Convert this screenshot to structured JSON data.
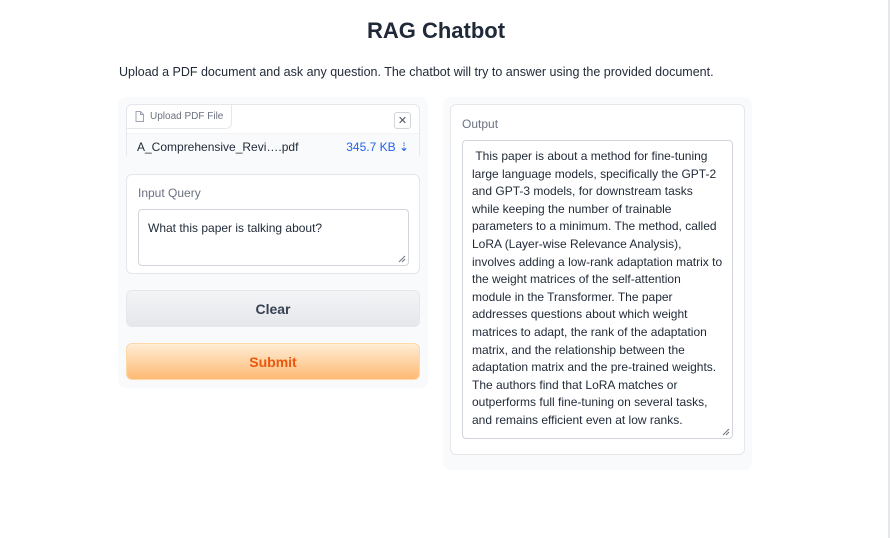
{
  "header": {
    "title": "RAG Chatbot",
    "description": "Upload a PDF document and ask any question. The chatbot will try to answer using the provided document."
  },
  "file_upload": {
    "label": "Upload PDF File",
    "label_icon": "file-icon",
    "close_glyph": "✕",
    "file_name": "A_Comprehensive_Revi….pdf",
    "file_size": "345.7 KB ⇣"
  },
  "query": {
    "label": "Input Query",
    "value": "What this paper is talking about?"
  },
  "buttons": {
    "clear_label": "Clear",
    "submit_label": "Submit"
  },
  "output": {
    "label": "Output",
    "value": " This paper is about a method for fine-tuning large language models, specifically the GPT-2 and GPT-3 models, for downstream tasks while keeping the number of trainable parameters to a minimum. The method, called LoRA (Layer-wise Relevance Analysis), involves adding a low-rank adaptation matrix to the weight matrices of the self-attention module in the Transformer. The paper addresses questions about which weight matrices to adapt, the rank of the adaptation matrix, and the relationship between the adaptation matrix and the pre-trained weights. The authors find that LoRA matches or outperforms full fine-tuning on several tasks, and remains efficient even at low ranks."
  },
  "colors": {
    "accent": "#ea580c",
    "link": "#2563eb"
  }
}
